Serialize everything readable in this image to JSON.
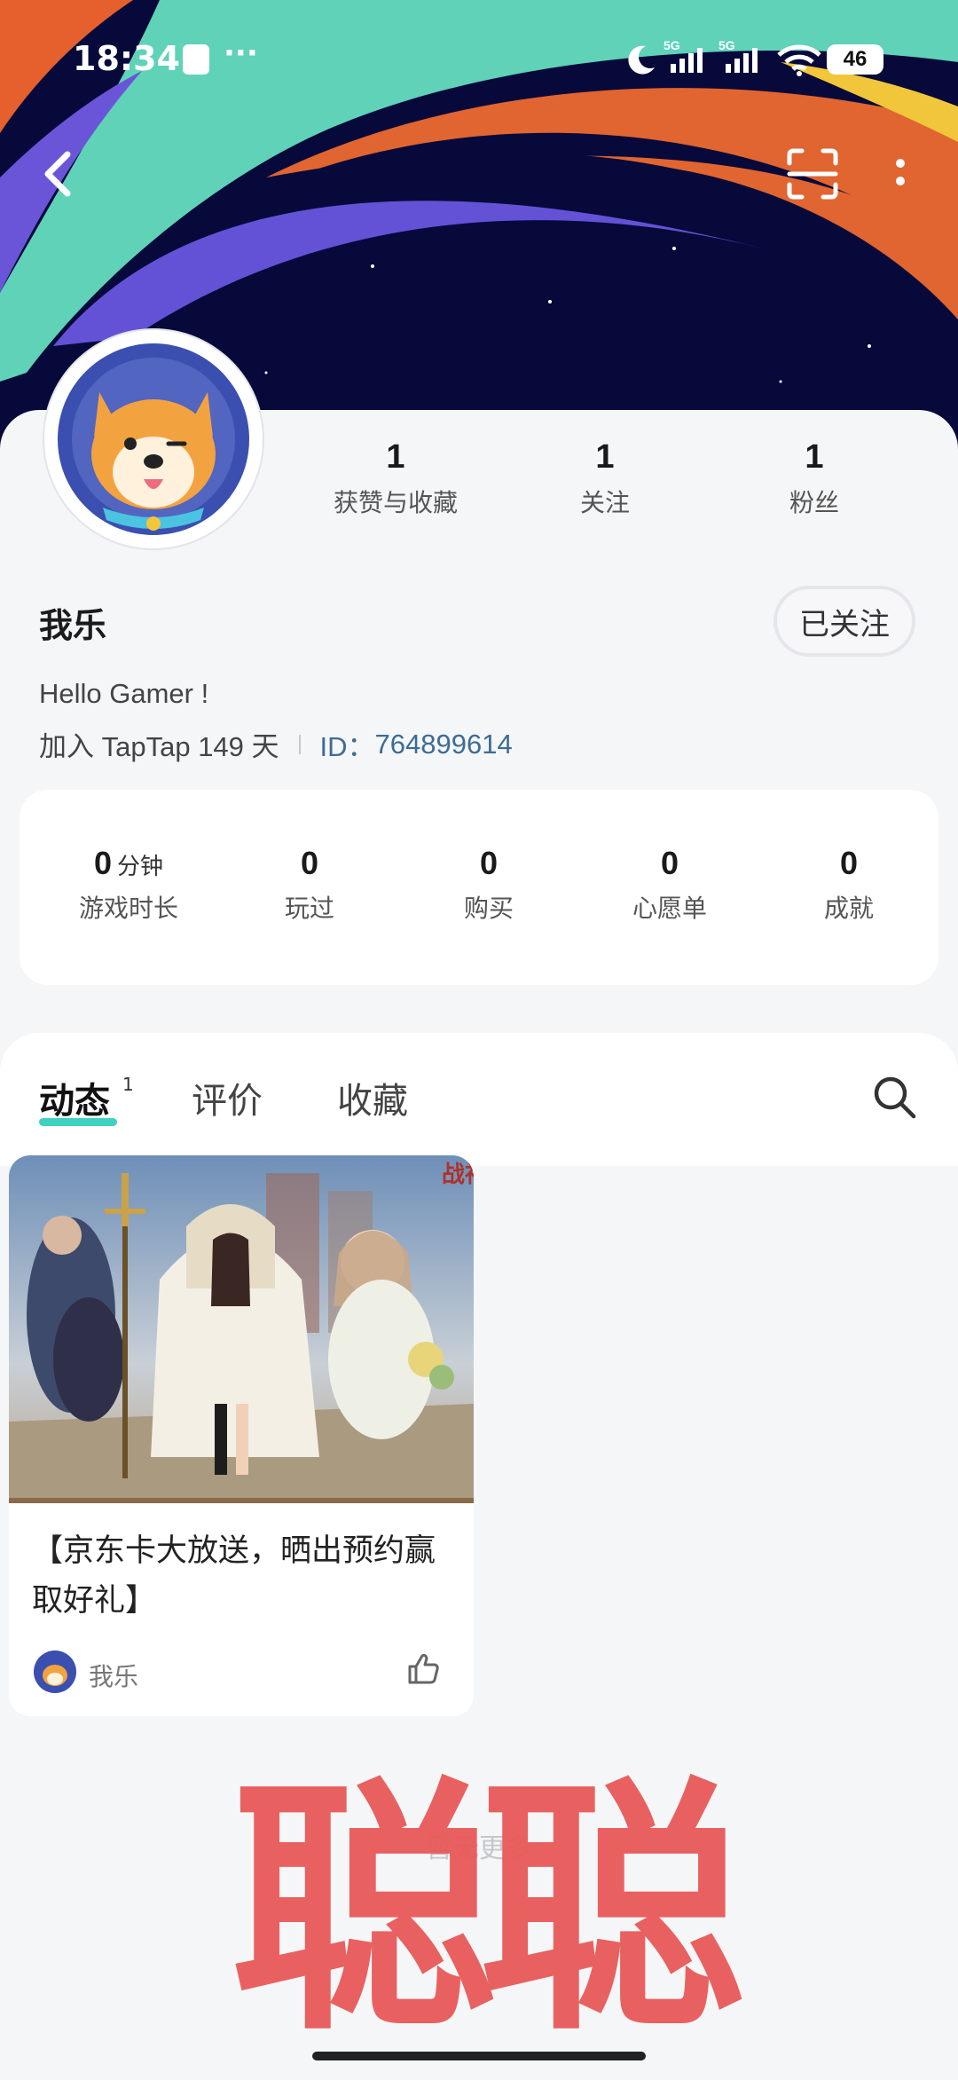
{
  "status_bar": {
    "time": "18:34",
    "battery": "46",
    "network": "5G"
  },
  "profile": {
    "stats": [
      {
        "value": "1",
        "label": "获赞与收藏"
      },
      {
        "value": "1",
        "label": "关注"
      },
      {
        "value": "1",
        "label": "粉丝"
      }
    ],
    "username": "我乐",
    "follow_button": "已关注",
    "bio": "Hello Gamer !",
    "joined": "加入 TapTap 149 天",
    "id_label": "ID：",
    "id_value": "764899614"
  },
  "game_stats": [
    {
      "value": "0",
      "unit": "分钟",
      "label": "游戏时长"
    },
    {
      "value": "0",
      "unit": "",
      "label": "玩过"
    },
    {
      "value": "0",
      "unit": "",
      "label": "购买"
    },
    {
      "value": "0",
      "unit": "",
      "label": "心愿单"
    },
    {
      "value": "0",
      "unit": "",
      "label": "成就"
    }
  ],
  "tabs": [
    {
      "label": "动态",
      "badge": "1"
    },
    {
      "label": "评价"
    },
    {
      "label": "收藏"
    }
  ],
  "post": {
    "title": "【京东卡大放送，晒出预约赢取好礼】",
    "author": "我乐",
    "image_text": "战神"
  },
  "footer": {
    "no_more": "暂无更多"
  },
  "watermark": "聪聪",
  "colors": {
    "accent": "#3fd2c1",
    "id_link": "#3d6c95",
    "watermark": "#e85a58"
  }
}
